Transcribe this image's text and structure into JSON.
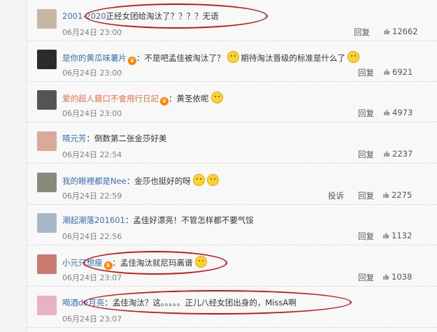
{
  "comments": [
    {
      "user": "2001-2020",
      "user_color": "blue",
      "badge": false,
      "text": "正经女团给淘汰了？？？？无语",
      "emojis": 0,
      "time": "06月24日 23:00",
      "report": "",
      "reply": "回复",
      "likes": "12662",
      "avatar_color": "#c9b7a5"
    },
    {
      "user": "是你的黄瓜味薯片",
      "user_color": "blue",
      "badge": true,
      "text": "：不是吧孟佳被淘汰了？",
      "emojis": 1,
      "text2": "期待淘汰晋级的标准是什么了",
      "emojis2": 1,
      "time": "06月24日 23:00",
      "report": "",
      "reply": "回复",
      "likes": "6921",
      "avatar_color": "#2b2b2b"
    },
    {
      "user": "爱的超人籍口不會飛行日記",
      "user_color": "orange",
      "badge": true,
      "text": "：黄圣依呢",
      "emojis": 1,
      "time": "06月24日 23:00",
      "report": "",
      "reply": "回复",
      "likes": "4973",
      "avatar_color": "#555"
    },
    {
      "user": "晴元芳",
      "user_color": "blue",
      "badge": false,
      "text": "：倒数第二张金莎好美",
      "emojis": 0,
      "time": "06月24日 22:54",
      "report": "",
      "reply": "回复",
      "likes": "2237",
      "avatar_color": "#d9a99a"
    },
    {
      "user": "我的眼裡都是Nee",
      "user_color": "blue",
      "badge": false,
      "text": "：金莎也挺好的呀",
      "emojis": 2,
      "time": "06月24日 22:59",
      "report": "投诉",
      "reply": "回复",
      "likes": "2275",
      "avatar_color": "#8a8a7a"
    },
    {
      "user": "潮起潮落201601",
      "user_color": "blue",
      "badge": false,
      "text": "：孟佳好漂亮！不管怎样都不要气馁",
      "emojis": 0,
      "time": "06月24日 22:56",
      "report": "",
      "reply": "回复",
      "likes": "1132",
      "avatar_color": "#a9b8c8"
    },
    {
      "user": "小元只想瘦",
      "user_color": "blue",
      "badge": true,
      "text": "：孟佳淘汰就尼玛离谱",
      "emojis": 1,
      "time": "06月24日 23:07",
      "report": "",
      "reply": "回复",
      "likes": "1038",
      "avatar_color": "#c77a6e"
    },
    {
      "user": "喝酒de月亮",
      "user_color": "blue",
      "badge": false,
      "text": "：孟佳淘汰？这。。。。。正儿八经女团出身的，MissA啊",
      "emojis": 0,
      "time": "06月24日 23:07",
      "report": "",
      "reply": "",
      "likes": "",
      "avatar_color": "#e7b3c0"
    }
  ],
  "badge_glyph": "♛",
  "thumb_icon": "thumbs-up-icon",
  "watermark": "",
  "highlight_color": "#c81414"
}
